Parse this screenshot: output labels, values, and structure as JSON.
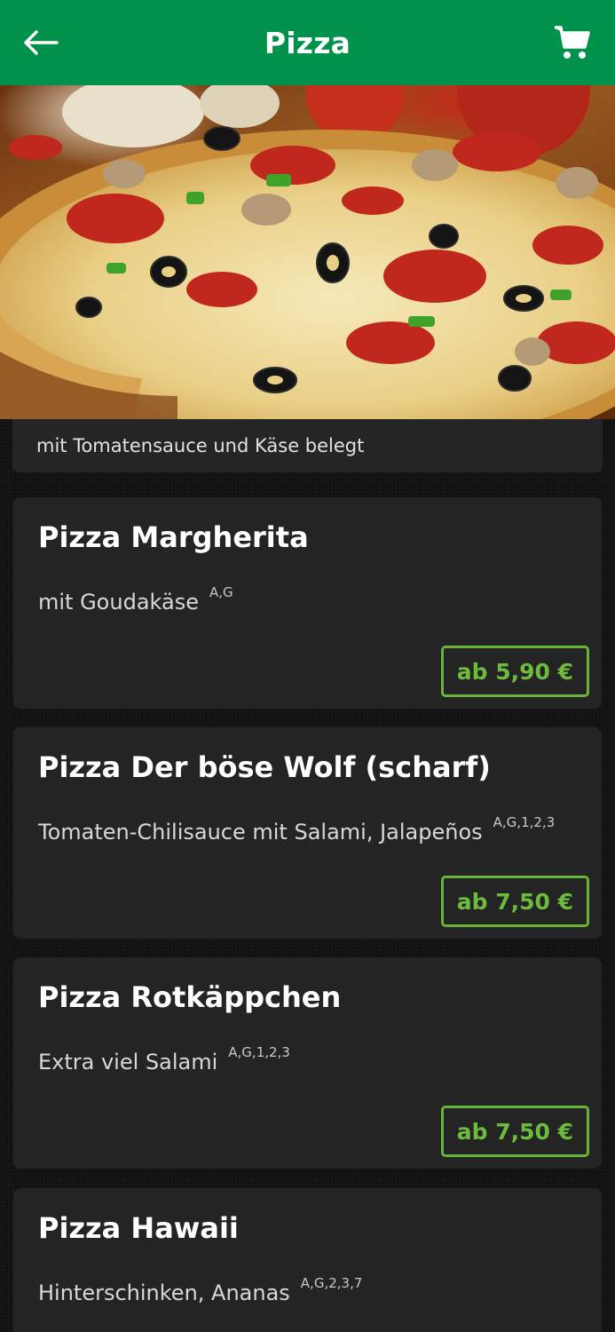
{
  "header": {
    "title": "Pizza",
    "back_icon": "arrow-left-icon",
    "cart_icon": "shopping-cart-icon",
    "color": "#00924a"
  },
  "category": {
    "description": "mit Tomatensauce und Käse belegt"
  },
  "items": [
    {
      "name": "Pizza Margherita",
      "description": "mit Goudakäse",
      "allergens": "A,G",
      "price": "ab 5,90 €"
    },
    {
      "name": "Pizza Der böse Wolf (scharf)",
      "description": "Tomaten-Chilisauce mit Salami, Jalapeños",
      "allergens": "A,G,1,2,3",
      "price": "ab 7,50 €"
    },
    {
      "name": "Pizza Rotkäppchen",
      "description": "Extra viel Salami",
      "allergens": "A,G,1,2,3",
      "price": "ab 7,50 €"
    },
    {
      "name": "Pizza Hawaii",
      "description": "Hinterschinken, Ananas",
      "allergens": "A,G,2,3,7",
      "price": ""
    }
  ],
  "colors": {
    "price_accent": "#6dbb3b",
    "card_background": "#242424"
  }
}
